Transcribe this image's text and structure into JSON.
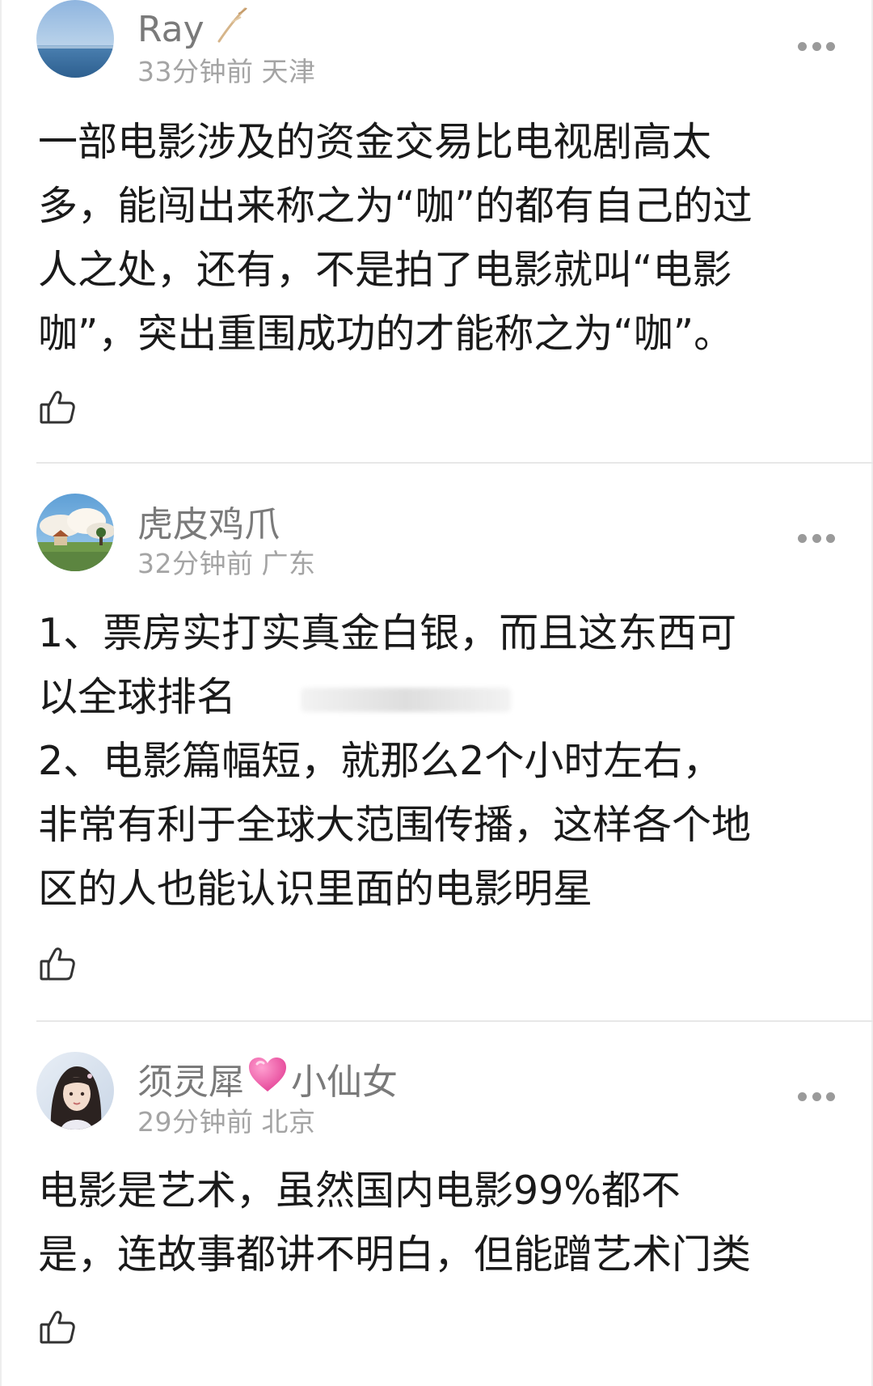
{
  "comments": [
    {
      "username": "Ray",
      "time": "33分钟前",
      "location": "天津",
      "lines": [
        "一部电影涉及的资金交易比电视剧高太",
        "多，能闯出来称之为“咖”的都有自己的过",
        "人之处，还有，不是拍了电影就叫“电影",
        "咖”，突出重围成功的才能称之为“咖”。"
      ]
    },
    {
      "username": "虎皮鸡爪",
      "time": "32分钟前",
      "location": "广东",
      "lines": [
        "1、票房实打实真金白银，而且这东西可",
        "以全球排名",
        "2、电影篇幅短，就那么2个小时左右，",
        "非常有利于全球大范围传播，这样各个地",
        "区的人也能认识里面的电影明星"
      ]
    },
    {
      "username_part1": "须灵犀",
      "username_part2": "小仙女",
      "time": "29分钟前",
      "location": "北京",
      "lines": [
        "电影是艺术，虽然国内电影99%都不",
        "是，连故事都讲不明白，但能蹭艺术门类"
      ]
    }
  ],
  "icons": {
    "more": "more-dots-icon",
    "like": "thumbs-up-icon",
    "badge": "feather-badge-icon",
    "heart": "pink-heart-icon"
  },
  "colors": {
    "username": "#7a7a7a",
    "meta": "#a4a4a4",
    "body_text": "#1a1a1a",
    "divider": "#e7e7e7",
    "heart": "#f25aa8"
  }
}
